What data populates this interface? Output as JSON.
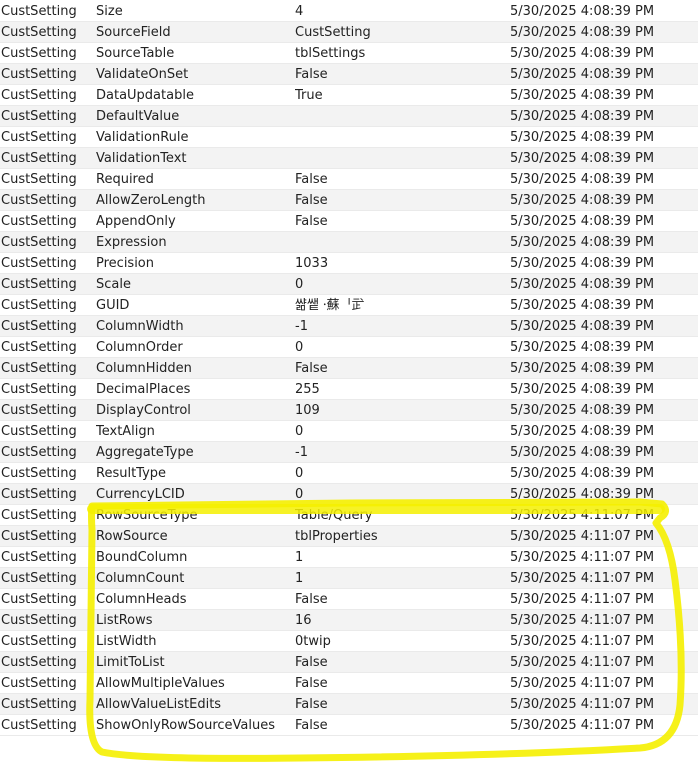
{
  "grid": {
    "rows": [
      {
        "object": "CustSetting",
        "property": "Size",
        "value": "4",
        "modified": "5/30/2025 4:08:39 PM"
      },
      {
        "object": "CustSetting",
        "property": "SourceField",
        "value": "CustSetting",
        "modified": "5/30/2025 4:08:39 PM"
      },
      {
        "object": "CustSetting",
        "property": "SourceTable",
        "value": "tblSettings",
        "modified": "5/30/2025 4:08:39 PM"
      },
      {
        "object": "CustSetting",
        "property": "ValidateOnSet",
        "value": "False",
        "modified": "5/30/2025 4:08:39 PM"
      },
      {
        "object": "CustSetting",
        "property": "DataUpdatable",
        "value": "True",
        "modified": "5/30/2025 4:08:39 PM"
      },
      {
        "object": "CustSetting",
        "property": "DefaultValue",
        "value": "",
        "modified": "5/30/2025 4:08:39 PM"
      },
      {
        "object": "CustSetting",
        "property": "ValidationRule",
        "value": "",
        "modified": "5/30/2025 4:08:39 PM"
      },
      {
        "object": "CustSetting",
        "property": "ValidationText",
        "value": "",
        "modified": "5/30/2025 4:08:39 PM"
      },
      {
        "object": "CustSetting",
        "property": "Required",
        "value": "False",
        "modified": "5/30/2025 4:08:39 PM"
      },
      {
        "object": "CustSetting",
        "property": "AllowZeroLength",
        "value": "False",
        "modified": "5/30/2025 4:08:39 PM"
      },
      {
        "object": "CustSetting",
        "property": "AppendOnly",
        "value": "False",
        "modified": "5/30/2025 4:08:39 PM"
      },
      {
        "object": "CustSetting",
        "property": "Expression",
        "value": "",
        "modified": "5/30/2025 4:08:39 PM"
      },
      {
        "object": "CustSetting",
        "property": "Precision",
        "value": "1033",
        "modified": "5/30/2025 4:08:39 PM"
      },
      {
        "object": "CustSetting",
        "property": "Scale",
        "value": "0",
        "modified": "5/30/2025 4:08:39 PM"
      },
      {
        "object": "CustSetting",
        "property": "GUID",
        "value": "쌺쌭 ⸱蘇ᅵ㱐",
        "modified": "5/30/2025 4:08:39 PM"
      },
      {
        "object": "CustSetting",
        "property": "ColumnWidth",
        "value": "-1",
        "modified": "5/30/2025 4:08:39 PM"
      },
      {
        "object": "CustSetting",
        "property": "ColumnOrder",
        "value": "0",
        "modified": "5/30/2025 4:08:39 PM"
      },
      {
        "object": "CustSetting",
        "property": "ColumnHidden",
        "value": "False",
        "modified": "5/30/2025 4:08:39 PM"
      },
      {
        "object": "CustSetting",
        "property": "DecimalPlaces",
        "value": "255",
        "modified": "5/30/2025 4:08:39 PM"
      },
      {
        "object": "CustSetting",
        "property": "DisplayControl",
        "value": "109",
        "modified": "5/30/2025 4:08:39 PM"
      },
      {
        "object": "CustSetting",
        "property": "TextAlign",
        "value": "0",
        "modified": "5/30/2025 4:08:39 PM"
      },
      {
        "object": "CustSetting",
        "property": "AggregateType",
        "value": "-1",
        "modified": "5/30/2025 4:08:39 PM"
      },
      {
        "object": "CustSetting",
        "property": "ResultType",
        "value": "0",
        "modified": "5/30/2025 4:08:39 PM"
      },
      {
        "object": "CustSetting",
        "property": "CurrencyLCID",
        "value": "0",
        "modified": "5/30/2025 4:08:39 PM"
      },
      {
        "object": "CustSetting",
        "property": "RowSourceType",
        "value": "Table/Query",
        "modified": "5/30/2025 4:11:07 PM"
      },
      {
        "object": "CustSetting",
        "property": "RowSource",
        "value": "tblProperties",
        "modified": "5/30/2025 4:11:07 PM"
      },
      {
        "object": "CustSetting",
        "property": "BoundColumn",
        "value": "1",
        "modified": "5/30/2025 4:11:07 PM"
      },
      {
        "object": "CustSetting",
        "property": "ColumnCount",
        "value": "1",
        "modified": "5/30/2025 4:11:07 PM"
      },
      {
        "object": "CustSetting",
        "property": "ColumnHeads",
        "value": "False",
        "modified": "5/30/2025 4:11:07 PM"
      },
      {
        "object": "CustSetting",
        "property": "ListRows",
        "value": "16",
        "modified": "5/30/2025 4:11:07 PM"
      },
      {
        "object": "CustSetting",
        "property": "ListWidth",
        "value": "0twip",
        "modified": "5/30/2025 4:11:07 PM"
      },
      {
        "object": "CustSetting",
        "property": "LimitToList",
        "value": "False",
        "modified": "5/30/2025 4:11:07 PM"
      },
      {
        "object": "CustSetting",
        "property": "AllowMultipleValues",
        "value": "False",
        "modified": "5/30/2025 4:11:07 PM"
      },
      {
        "object": "CustSetting",
        "property": "AllowValueListEdits",
        "value": "False",
        "modified": "5/30/2025 4:11:07 PM"
      },
      {
        "object": "CustSetting",
        "property": "ShowOnlyRowSourceValues",
        "value": "False",
        "modified": "5/30/2025 4:11:07 PM"
      }
    ]
  },
  "highlight": {
    "color": "#f5f000"
  }
}
